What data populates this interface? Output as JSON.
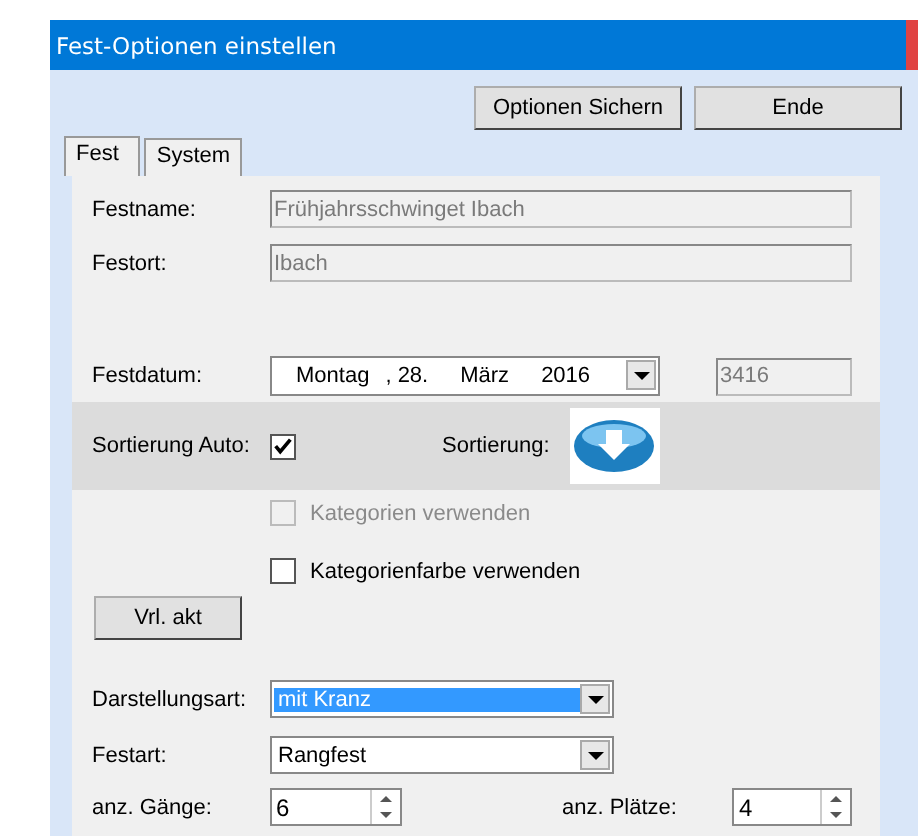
{
  "window": {
    "title": "Fest-Optionen einstellen"
  },
  "buttons": [
    {
      "label": "Optionen Sichern"
    },
    {
      "label": "Ende"
    }
  ],
  "tabs": [
    {
      "label": "Fest",
      "selected": true
    },
    {
      "label": "System",
      "selected": false
    }
  ],
  "fields": [
    {
      "label": "Festname:",
      "value": "Frühjahrsschwinget Ibach"
    },
    {
      "label": "Festort:",
      "value": "Ibach"
    }
  ],
  "festdatum": {
    "label": "Festdatum:",
    "weekday": "Montag",
    "day": ", 28.",
    "month": "März",
    "year": "2016",
    "number": "3416"
  },
  "sortierung_auto": {
    "label": "Sortierung Auto:",
    "checked": true
  },
  "sortierung": {
    "label": "Sortierung:"
  },
  "checkboxes": [
    {
      "label": "Kategorien verwenden",
      "checked": false,
      "disabled": true
    },
    {
      "label": "Kategorienfarbe verwenden",
      "checked": false,
      "disabled": false
    }
  ],
  "refresh_button": {
    "label": "Vrl. akt"
  },
  "dropdowns": [
    {
      "label": "Darstellungsart:",
      "value": "mit Kranz",
      "selected": true
    },
    {
      "label": "Festart:",
      "value": "Rangfest",
      "selected": false
    }
  ],
  "spinners": [
    {
      "label": "anz. Gänge:",
      "value": "6"
    },
    {
      "label": "anz. Plätze:",
      "value": "4"
    }
  ]
}
